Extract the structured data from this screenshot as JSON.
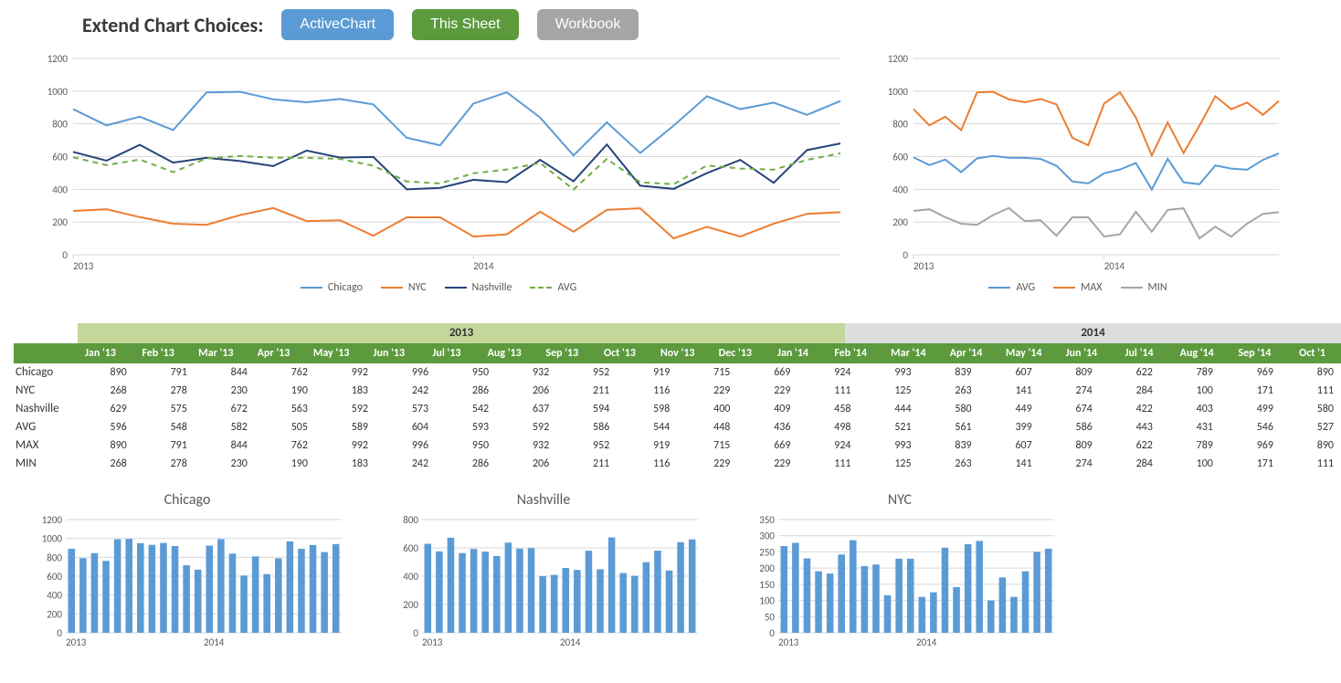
{
  "header": {
    "title": "Extend Chart Choices:",
    "buttons": {
      "active": "ActiveChart",
      "sheet": "This Sheet",
      "workbook": "Workbook"
    }
  },
  "months": [
    "Jan '13",
    "Feb '13",
    "Mar '13",
    "Apr '13",
    "May '13",
    "Jun '13",
    "Jul '13",
    "Aug '13",
    "Sep '13",
    "Oct '13",
    "Nov '13",
    "Dec '13",
    "Jan '14",
    "Feb '14",
    "Mar '14",
    "Apr '14",
    "May '14",
    "Jun '14",
    "Jul '14",
    "Aug '14",
    "Sep '14",
    "Oct '1"
  ],
  "years": {
    "y2013": "2013",
    "y2014": "2014"
  },
  "rows": {
    "Chicago": [
      890,
      791,
      844,
      762,
      992,
      996,
      950,
      932,
      952,
      919,
      715,
      669,
      924,
      993,
      839,
      607,
      809,
      622,
      789,
      969,
      890
    ],
    "NYC": [
      268,
      278,
      230,
      190,
      183,
      242,
      286,
      206,
      211,
      116,
      229,
      229,
      111,
      125,
      263,
      141,
      274,
      284,
      100,
      171,
      111
    ],
    "Nashville": [
      629,
      575,
      672,
      563,
      592,
      573,
      542,
      637,
      594,
      598,
      400,
      409,
      458,
      444,
      580,
      449,
      674,
      422,
      403,
      499,
      580
    ],
    "AVG": [
      596,
      548,
      582,
      505,
      589,
      604,
      593,
      592,
      586,
      544,
      448,
      436,
      498,
      521,
      561,
      399,
      586,
      443,
      431,
      546,
      527
    ],
    "MAX": [
      890,
      791,
      844,
      762,
      992,
      996,
      950,
      932,
      952,
      919,
      715,
      669,
      924,
      993,
      839,
      607,
      809,
      622,
      789,
      969,
      890
    ],
    "MIN": [
      268,
      278,
      230,
      190,
      183,
      242,
      286,
      206,
      211,
      116,
      229,
      229,
      111,
      125,
      263,
      141,
      274,
      284,
      100,
      171,
      111
    ]
  },
  "chart_data": [
    {
      "type": "line",
      "title": "",
      "x": [
        "2013-01",
        "2013-02",
        "2013-03",
        "2013-04",
        "2013-05",
        "2013-06",
        "2013-07",
        "2013-08",
        "2013-09",
        "2013-10",
        "2013-11",
        "2013-12",
        "2014-01",
        "2014-02",
        "2014-03",
        "2014-04",
        "2014-05",
        "2014-06",
        "2014-07",
        "2014-08",
        "2014-09",
        "2014-10",
        "2014-11",
        "2014-12"
      ],
      "series": [
        {
          "name": "Chicago",
          "color": "#5b9bd5",
          "values": [
            890,
            791,
            844,
            762,
            992,
            996,
            950,
            932,
            952,
            919,
            715,
            669,
            924,
            993,
            839,
            607,
            809,
            622,
            789,
            969,
            890,
            930,
            855,
            940
          ]
        },
        {
          "name": "NYC",
          "color": "#ed7d31",
          "values": [
            268,
            278,
            230,
            190,
            183,
            242,
            286,
            206,
            211,
            116,
            229,
            229,
            111,
            125,
            263,
            141,
            274,
            284,
            100,
            171,
            111,
            190,
            250,
            260
          ]
        },
        {
          "name": "Nashville",
          "color": "#264478",
          "values": [
            629,
            575,
            672,
            563,
            592,
            573,
            542,
            637,
            594,
            598,
            400,
            409,
            458,
            444,
            580,
            449,
            674,
            422,
            403,
            499,
            580,
            440,
            640,
            680
          ]
        },
        {
          "name": "AVG",
          "color": "#70ad47",
          "dashed": true,
          "values": [
            596,
            548,
            582,
            505,
            589,
            604,
            593,
            592,
            586,
            544,
            448,
            436,
            498,
            521,
            561,
            399,
            586,
            443,
            431,
            546,
            527,
            520,
            580,
            620
          ]
        }
      ],
      "ylim": [
        0,
        1200
      ],
      "yticks": [
        0,
        200,
        400,
        600,
        800,
        1000,
        1200
      ],
      "xticks": [
        "2013",
        "2014"
      ]
    },
    {
      "type": "line",
      "title": "",
      "x": [
        "2013-01",
        "2013-02",
        "2013-03",
        "2013-04",
        "2013-05",
        "2013-06",
        "2013-07",
        "2013-08",
        "2013-09",
        "2013-10",
        "2013-11",
        "2013-12",
        "2014-01",
        "2014-02",
        "2014-03",
        "2014-04",
        "2014-05",
        "2014-06",
        "2014-07",
        "2014-08",
        "2014-09",
        "2014-10",
        "2014-11",
        "2014-12"
      ],
      "series": [
        {
          "name": "AVG",
          "color": "#5b9bd5",
          "values": [
            596,
            548,
            582,
            505,
            589,
            604,
            593,
            592,
            586,
            544,
            448,
            436,
            498,
            521,
            561,
            399,
            586,
            443,
            431,
            546,
            527,
            520,
            580,
            620
          ]
        },
        {
          "name": "MAX",
          "color": "#ed7d31",
          "values": [
            890,
            791,
            844,
            762,
            992,
            996,
            950,
            932,
            952,
            919,
            715,
            669,
            924,
            993,
            839,
            607,
            809,
            622,
            789,
            969,
            890,
            930,
            855,
            940
          ]
        },
        {
          "name": "MIN",
          "color": "#a5a5a5",
          "values": [
            268,
            278,
            230,
            190,
            183,
            242,
            286,
            206,
            211,
            116,
            229,
            229,
            111,
            125,
            263,
            141,
            274,
            284,
            100,
            171,
            111,
            190,
            250,
            260
          ]
        }
      ],
      "ylim": [
        0,
        1200
      ],
      "yticks": [
        0,
        200,
        400,
        600,
        800,
        1000,
        1200
      ],
      "xticks": [
        "2013",
        "2014"
      ]
    },
    {
      "type": "bar",
      "title": "Chicago",
      "categories": [
        "2013-01",
        "2013-02",
        "2013-03",
        "2013-04",
        "2013-05",
        "2013-06",
        "2013-07",
        "2013-08",
        "2013-09",
        "2013-10",
        "2013-11",
        "2013-12",
        "2014-01",
        "2014-02",
        "2014-03",
        "2014-04",
        "2014-05",
        "2014-06",
        "2014-07",
        "2014-08",
        "2014-09",
        "2014-10",
        "2014-11",
        "2014-12"
      ],
      "values": [
        890,
        791,
        844,
        762,
        992,
        996,
        950,
        932,
        952,
        919,
        715,
        669,
        924,
        993,
        839,
        607,
        809,
        622,
        789,
        969,
        890,
        930,
        855,
        940
      ],
      "ylim": [
        0,
        1200
      ],
      "yticks": [
        0,
        200,
        400,
        600,
        800,
        1000,
        1200
      ],
      "xticks": [
        "2013",
        "2014"
      ],
      "color": "#5b9bd5"
    },
    {
      "type": "bar",
      "title": "Nashville",
      "categories": [
        "2013-01",
        "2013-02",
        "2013-03",
        "2013-04",
        "2013-05",
        "2013-06",
        "2013-07",
        "2013-08",
        "2013-09",
        "2013-10",
        "2013-11",
        "2013-12",
        "2014-01",
        "2014-02",
        "2014-03",
        "2014-04",
        "2014-05",
        "2014-06",
        "2014-07",
        "2014-08",
        "2014-09",
        "2014-10",
        "2014-11",
        "2014-12"
      ],
      "values": [
        629,
        575,
        672,
        563,
        592,
        573,
        542,
        637,
        594,
        598,
        400,
        409,
        458,
        444,
        580,
        449,
        674,
        422,
        403,
        499,
        580,
        440,
        640,
        660
      ],
      "ylim": [
        0,
        800
      ],
      "yticks": [
        0,
        200,
        400,
        600,
        800
      ],
      "xticks": [
        "2013",
        "2014"
      ],
      "color": "#5b9bd5"
    },
    {
      "type": "bar",
      "title": "NYC",
      "categories": [
        "2013-01",
        "2013-02",
        "2013-03",
        "2013-04",
        "2013-05",
        "2013-06",
        "2013-07",
        "2013-08",
        "2013-09",
        "2013-10",
        "2013-11",
        "2013-12",
        "2014-01",
        "2014-02",
        "2014-03",
        "2014-04",
        "2014-05",
        "2014-06",
        "2014-07",
        "2014-08",
        "2014-09",
        "2014-10",
        "2014-11",
        "2014-12"
      ],
      "values": [
        268,
        278,
        230,
        190,
        183,
        242,
        286,
        206,
        211,
        116,
        229,
        229,
        111,
        125,
        263,
        141,
        274,
        284,
        100,
        171,
        111,
        190,
        250,
        260
      ],
      "ylim": [
        0,
        350
      ],
      "yticks": [
        0,
        50,
        100,
        150,
        200,
        250,
        300,
        350
      ],
      "xticks": [
        "2013",
        "2014"
      ],
      "color": "#5b9bd5"
    }
  ]
}
